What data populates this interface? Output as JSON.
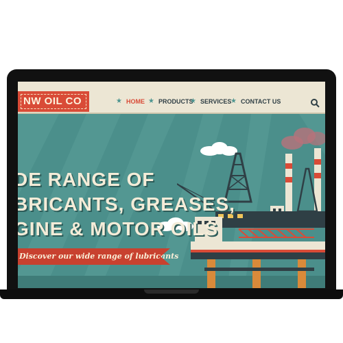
{
  "site": {
    "logo": "NW OIL CO",
    "nav": [
      {
        "label": "HOME",
        "active": true
      },
      {
        "label": "PRODUCTS",
        "active": false
      },
      {
        "label": "SERVICES",
        "active": false
      },
      {
        "label": "CONTACT US",
        "active": false
      }
    ]
  },
  "hero": {
    "line1": "DE RANGE OF",
    "line2": "BRICANTS, GREASES,",
    "line3": "GINE & MOTOR OILS",
    "cta": "Discover our wide range of lubricants"
  },
  "colors": {
    "accent": "#d94b37",
    "teal": "#4b8f8b",
    "cream": "#ece6d4"
  },
  "icons": {
    "search": "search-icon",
    "nav_separator": "star-icon"
  }
}
